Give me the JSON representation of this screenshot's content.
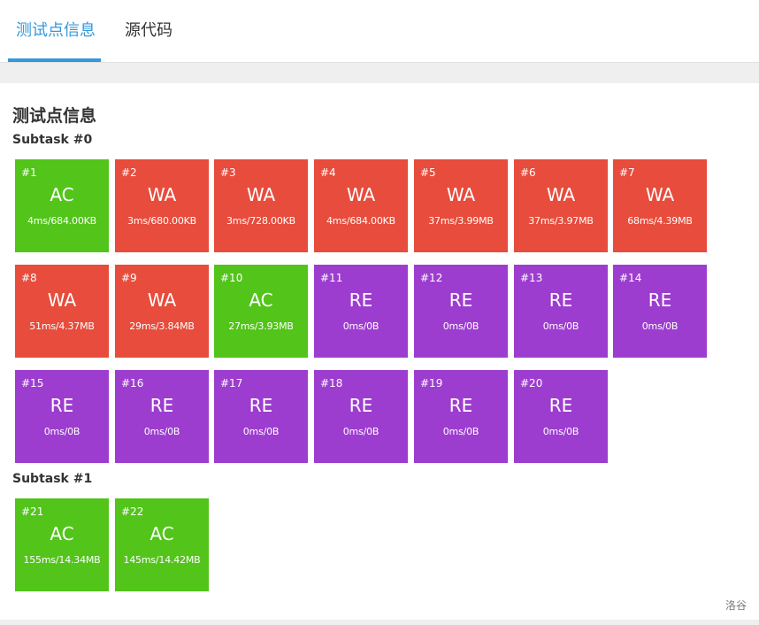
{
  "tabs": [
    {
      "label": "测试点信息",
      "active": true
    },
    {
      "label": "源代码",
      "active": false
    }
  ],
  "colors": {
    "AC": "#52c41a",
    "WA": "#e74c3c",
    "RE": "#9d3dcf",
    "accent": "#3498db"
  },
  "panel": {
    "title": "测试点信息",
    "subtasks": [
      {
        "title": "Subtask #0",
        "cases": [
          {
            "id": "#1",
            "status": "AC",
            "meta": "4ms/684.00KB"
          },
          {
            "id": "#2",
            "status": "WA",
            "meta": "3ms/680.00KB"
          },
          {
            "id": "#3",
            "status": "WA",
            "meta": "3ms/728.00KB"
          },
          {
            "id": "#4",
            "status": "WA",
            "meta": "4ms/684.00KB"
          },
          {
            "id": "#5",
            "status": "WA",
            "meta": "37ms/3.99MB"
          },
          {
            "id": "#6",
            "status": "WA",
            "meta": "37ms/3.97MB"
          },
          {
            "id": "#7",
            "status": "WA",
            "meta": "68ms/4.39MB"
          },
          {
            "id": "#8",
            "status": "WA",
            "meta": "51ms/4.37MB"
          },
          {
            "id": "#9",
            "status": "WA",
            "meta": "29ms/3.84MB"
          },
          {
            "id": "#10",
            "status": "AC",
            "meta": "27ms/3.93MB"
          },
          {
            "id": "#11",
            "status": "RE",
            "meta": "0ms/0B"
          },
          {
            "id": "#12",
            "status": "RE",
            "meta": "0ms/0B"
          },
          {
            "id": "#13",
            "status": "RE",
            "meta": "0ms/0B"
          },
          {
            "id": "#14",
            "status": "RE",
            "meta": "0ms/0B"
          },
          {
            "id": "#15",
            "status": "RE",
            "meta": "0ms/0B"
          },
          {
            "id": "#16",
            "status": "RE",
            "meta": "0ms/0B"
          },
          {
            "id": "#17",
            "status": "RE",
            "meta": "0ms/0B"
          },
          {
            "id": "#18",
            "status": "RE",
            "meta": "0ms/0B"
          },
          {
            "id": "#19",
            "status": "RE",
            "meta": "0ms/0B"
          },
          {
            "id": "#20",
            "status": "RE",
            "meta": "0ms/0B"
          }
        ]
      },
      {
        "title": "Subtask #1",
        "cases": [
          {
            "id": "#21",
            "status": "AC",
            "meta": "155ms/14.34MB"
          },
          {
            "id": "#22",
            "status": "AC",
            "meta": "145ms/14.42MB"
          }
        ]
      }
    ]
  },
  "footer": {
    "brand": "洛谷"
  }
}
